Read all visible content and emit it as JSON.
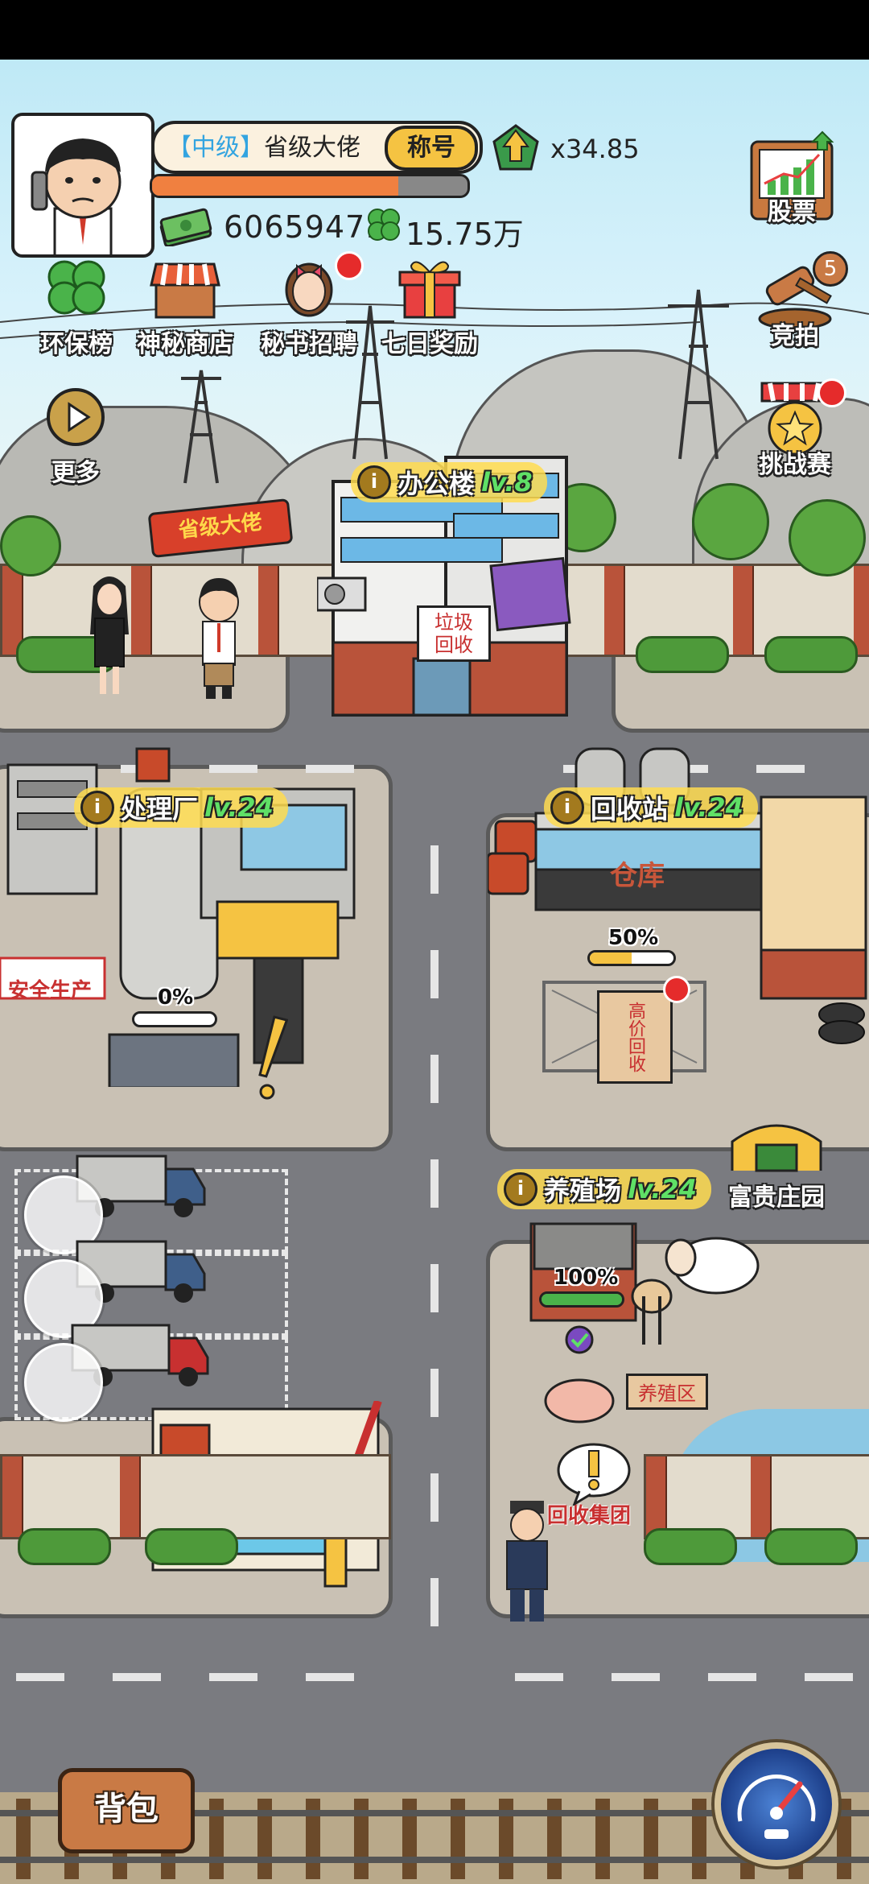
{
  "player": {
    "rank_level": "【中级】",
    "rank_title": "省级大佬",
    "title_button": "称号",
    "exp_progress": 0.78,
    "multiplier": "x34.85",
    "money_display": "6065947.",
    "clover_display": "15.75万"
  },
  "top_left_buttons": [
    {
      "label": "环保榜",
      "icon": "clover-icon"
    },
    {
      "label": "神秘商店",
      "icon": "shop-stall-icon"
    },
    {
      "label": "秘书招聘",
      "icon": "secretary-icon",
      "badge": true
    },
    {
      "label": "七日奖励",
      "icon": "gift-box-icon"
    }
  ],
  "right_buttons": {
    "stocks": "股票",
    "auction": "竞拍",
    "auction_count": "5",
    "challenge": "挑战赛"
  },
  "more_button": "更多",
  "rank_banner": "省级大佬",
  "buildings": {
    "office": {
      "name": "办公楼",
      "level": "lv.8",
      "sign_lines": [
        "垃圾",
        "回收"
      ]
    },
    "plant": {
      "name": "处理厂",
      "level": "lv.24",
      "progress_text": "0%",
      "progress": 0.0,
      "sign": "安全生产"
    },
    "recycle": {
      "name": "回收站",
      "level": "lv.24",
      "progress_text": "50%",
      "progress": 0.5,
      "warehouse": "仓库",
      "sign": "高价回收"
    },
    "farm": {
      "name": "养殖场",
      "level": "lv.24",
      "progress_text": "100%",
      "progress": 1.0,
      "sign": "养殖区"
    },
    "manor": {
      "name": "富贵庄园"
    },
    "hq": {
      "name": "回收集团"
    }
  },
  "bag_button": "背包",
  "colors": {
    "level_green": "#5fe066",
    "rank_blue": "#33a4e0",
    "title_gold": "#f5c342",
    "alert_red": "#e52b2b"
  }
}
